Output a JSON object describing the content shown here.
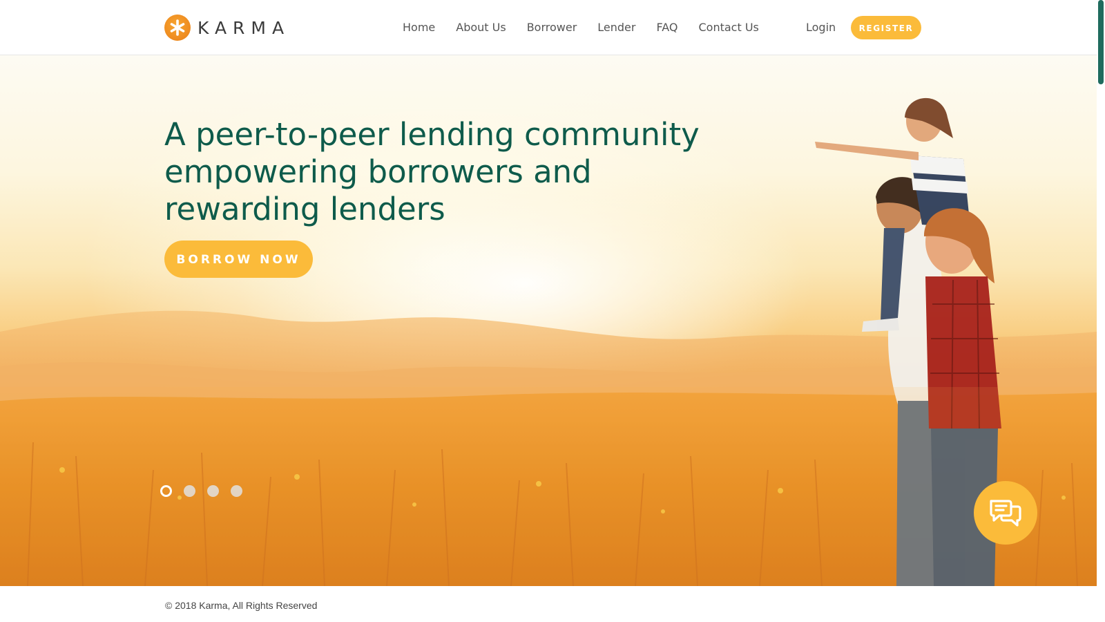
{
  "brand": {
    "name": "KARMA"
  },
  "nav": {
    "items": [
      {
        "label": "Home"
      },
      {
        "label": "About Us"
      },
      {
        "label": "Borrower"
      },
      {
        "label": "Lender"
      },
      {
        "label": "FAQ"
      },
      {
        "label": "Contact Us"
      }
    ],
    "login_label": "Login",
    "register_label": "REGISTER"
  },
  "hero": {
    "headline": "A peer-to-peer lending community empowering borrowers and rewarding lenders",
    "cta_label": "BORROW NOW",
    "slides_total": 4,
    "active_slide": 1,
    "image_subject": "family in a sunset wheat field"
  },
  "chat": {
    "icon": "chat-bubbles-icon"
  },
  "footer": {
    "copyright": "© 2018 Karma, All Rights Reserved"
  },
  "colors": {
    "brand_green": "#0e5b4b",
    "accent_yellow": "#fbbb3a",
    "logo_orange": "#ee8a1f",
    "nav_text": "#555555",
    "scrollbar": "#1f6b5e"
  }
}
